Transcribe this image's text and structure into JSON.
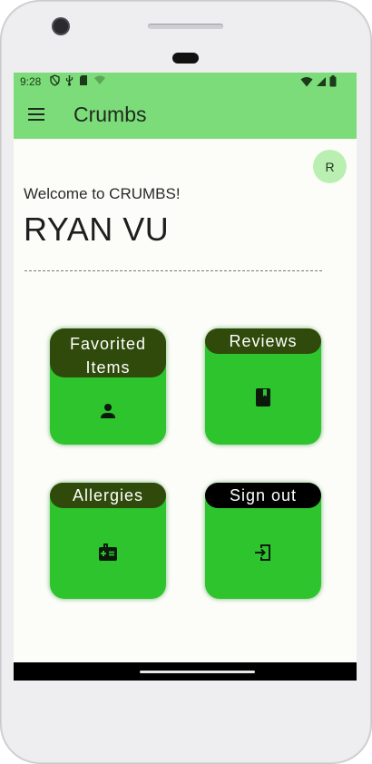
{
  "status_bar": {
    "time": "9:28",
    "icons_left": [
      "shield-icon",
      "usb-icon",
      "sd-card-icon",
      "wifi-outline-icon"
    ],
    "icons_right": [
      "wifi-icon",
      "signal-icon",
      "battery-icon"
    ]
  },
  "app_bar": {
    "title": "Crumbs",
    "menu_icon": "menu-icon",
    "background": "#7ddc7a"
  },
  "profile": {
    "avatar_initial": "R",
    "welcome_text": "Welcome to CRUMBS!",
    "user_name": "RYAN VU"
  },
  "tiles": [
    {
      "label": "Favorited Items",
      "icon": "person-icon",
      "label_bg": "#2f4a0a"
    },
    {
      "label": "Reviews",
      "icon": "book-icon",
      "label_bg": "#2f4a0a"
    },
    {
      "label": "Allergies",
      "icon": "medical-kit-icon",
      "label_bg": "#2f4a0a"
    },
    {
      "label": "Sign out",
      "icon": "logout-icon",
      "label_bg": "#000000"
    }
  ],
  "colors": {
    "tile_green": "#2ec42e",
    "screen_bg": "#fcfdf8",
    "avatar_bg": "#b9f0b2"
  }
}
